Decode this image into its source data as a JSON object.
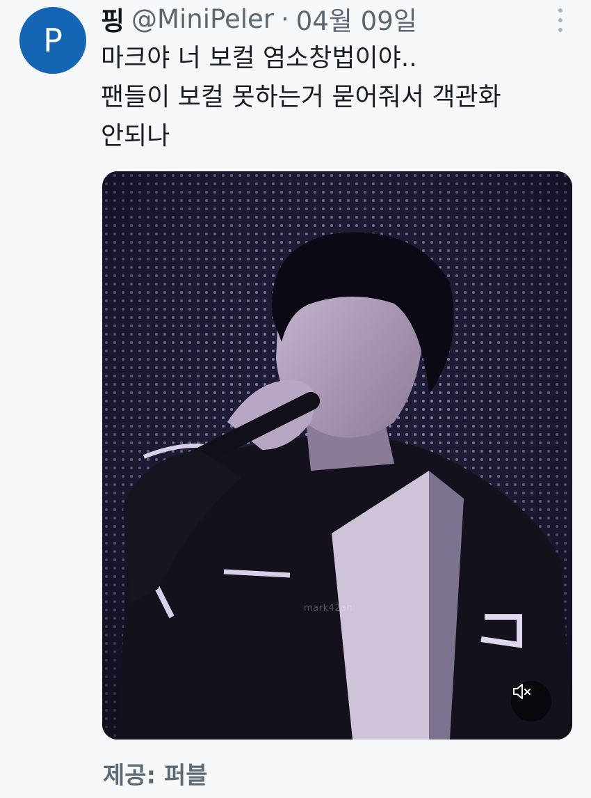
{
  "tweet": {
    "avatar_letter": "P",
    "display_name": "핑",
    "handle": "@MiniPeler",
    "separator": "·",
    "date": "04월 09일",
    "text_lines": [
      "마크야 너 보컬 염소창법이야..",
      "팬들이 보컬 못하는거 묻어줘서 객관화",
      "안되나"
    ],
    "media": {
      "watermark": "mark42an",
      "mute_icon": "speaker-muted-icon"
    },
    "more_icon": "more-vertical-icon"
  },
  "caption": "제공: 퍼블",
  "colors": {
    "avatar_bg": "#1565b5",
    "name": "#0f1419",
    "meta": "#5b6670",
    "stage_bg": "#1d1a33"
  }
}
